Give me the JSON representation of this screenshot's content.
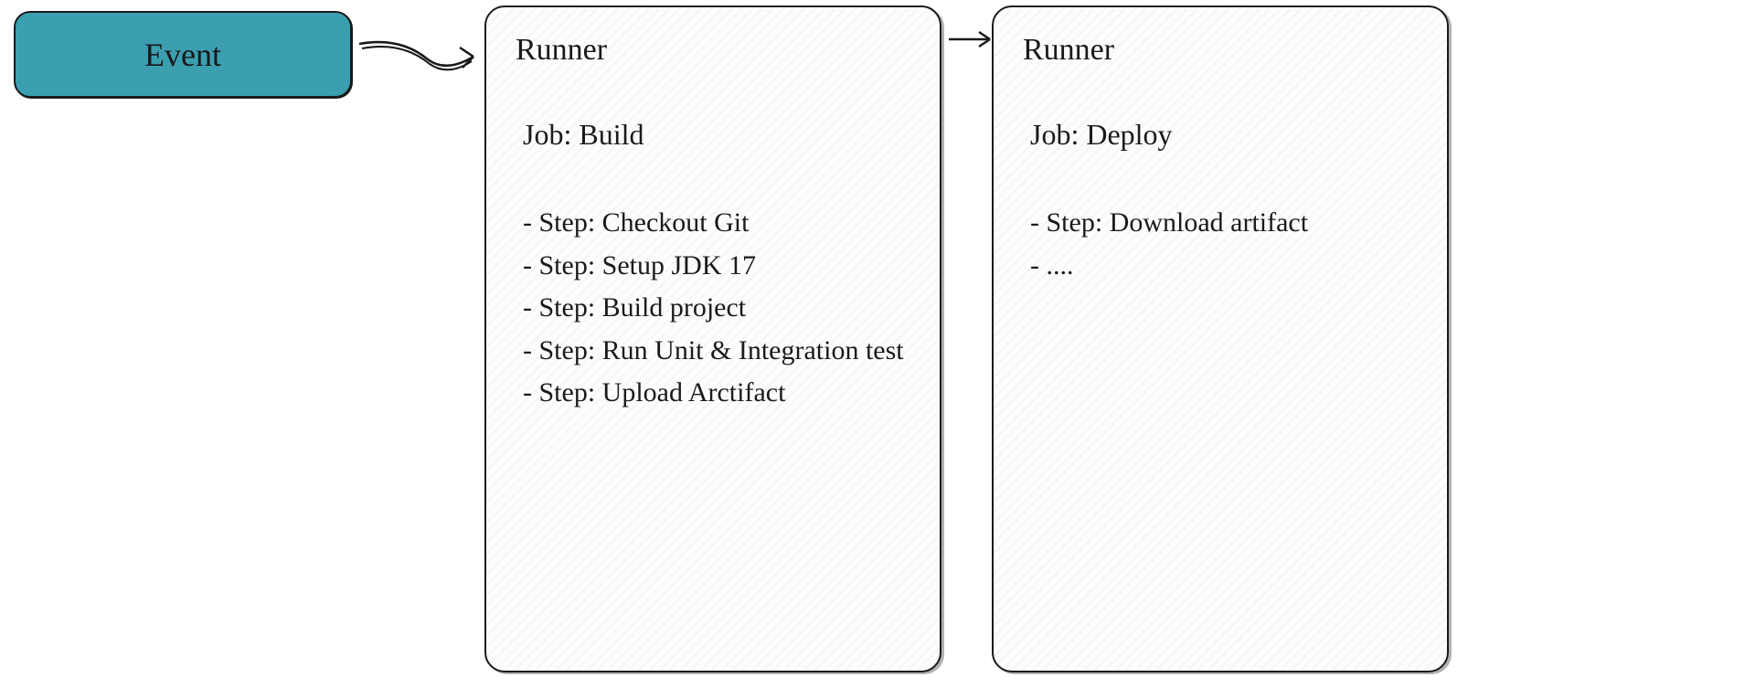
{
  "event": {
    "label": "Event"
  },
  "runner1": {
    "title": "Runner",
    "jobTitle": "Job: Build",
    "steps": [
      "- Step: Checkout Git",
      "- Step: Setup JDK 17",
      "- Step: Build project",
      "- Step: Run Unit & Integration test",
      "- Step: Upload Arctifact"
    ]
  },
  "runner2": {
    "title": "Runner",
    "jobTitle": "Job: Deploy",
    "steps": [
      "- Step: Download artifact",
      "- ...."
    ]
  }
}
